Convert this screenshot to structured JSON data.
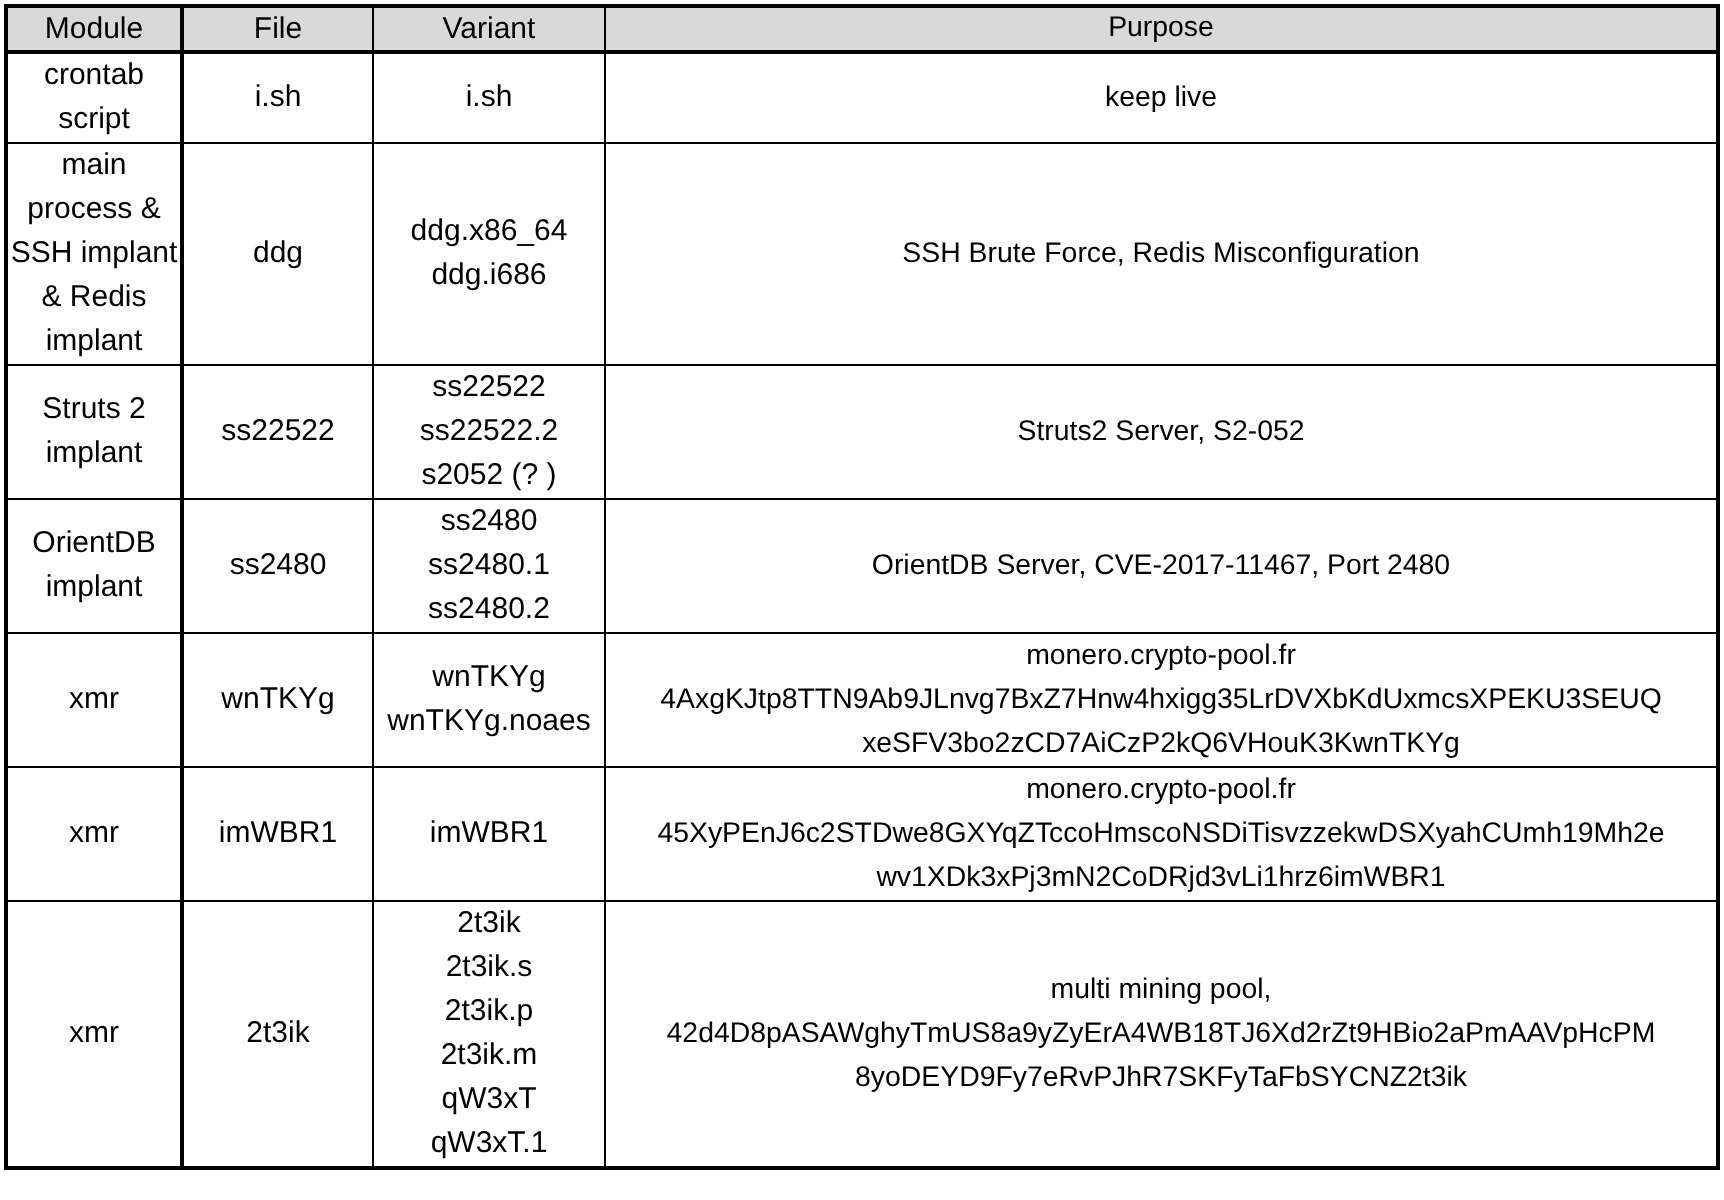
{
  "table": {
    "columns": [
      "Module",
      "File",
      "Variant",
      "Purpose"
    ],
    "rows": [
      {
        "module": "crontab script",
        "file": "i.sh",
        "variants": [
          "i.sh"
        ],
        "purpose": [
          "keep live"
        ]
      },
      {
        "module": "main process & SSH implant & Redis implant",
        "file": "ddg",
        "variants": [
          "ddg.x86_64",
          "ddg.i686"
        ],
        "purpose": [
          "SSH Brute Force,  Redis Misconfiguration"
        ]
      },
      {
        "module": "Struts 2 implant",
        "file": "ss22522",
        "variants": [
          "ss22522",
          "ss22522.2",
          "s2052 (? )"
        ],
        "purpose": [
          "Struts2 Server, S2-052"
        ]
      },
      {
        "module": "OrientDB implant",
        "file": "ss2480",
        "variants": [
          "ss2480",
          "ss2480.1",
          "ss2480.2"
        ],
        "purpose": [
          "OrientDB Server, CVE-2017-11467, Port 2480"
        ]
      },
      {
        "module": "xmr",
        "file": "wnTKYg",
        "variants": [
          "wnTKYg",
          "wnTKYg.noaes"
        ],
        "purpose": [
          "monero.crypto-pool.fr",
          "4AxgKJtp8TTN9Ab9JLnvg7BxZ7Hnw4hxigg35LrDVXbKdUxmcsXPEKU3SEUQ",
          "xeSFV3bo2zCD7AiCzP2kQ6VHouK3KwnTKYg"
        ]
      },
      {
        "module": "xmr",
        "file": "imWBR1",
        "variants": [
          "imWBR1"
        ],
        "purpose": [
          "monero.crypto-pool.fr",
          "45XyPEnJ6c2STDwe8GXYqZTccoHmscoNSDiTisvzzekwDSXyahCUmh19Mh2e",
          "wv1XDk3xPj3mN2CoDRjd3vLi1hrz6imWBR1"
        ]
      },
      {
        "module": "xmr",
        "file": "2t3ik",
        "variants": [
          "2t3ik",
          "2t3ik.s",
          "2t3ik.p",
          "2t3ik.m",
          "qW3xT",
          "qW3xT.1"
        ],
        "purpose": [
          "multi mining pool,",
          "42d4D8pASAWghyTmUS8a9yZyErA4WB18TJ6Xd2rZt9HBio2aPmAAVpHcPM",
          "8yoDEYD9Fy7eRvPJhR7SKFyTaFbSYCNZ2t3ik"
        ]
      }
    ]
  }
}
